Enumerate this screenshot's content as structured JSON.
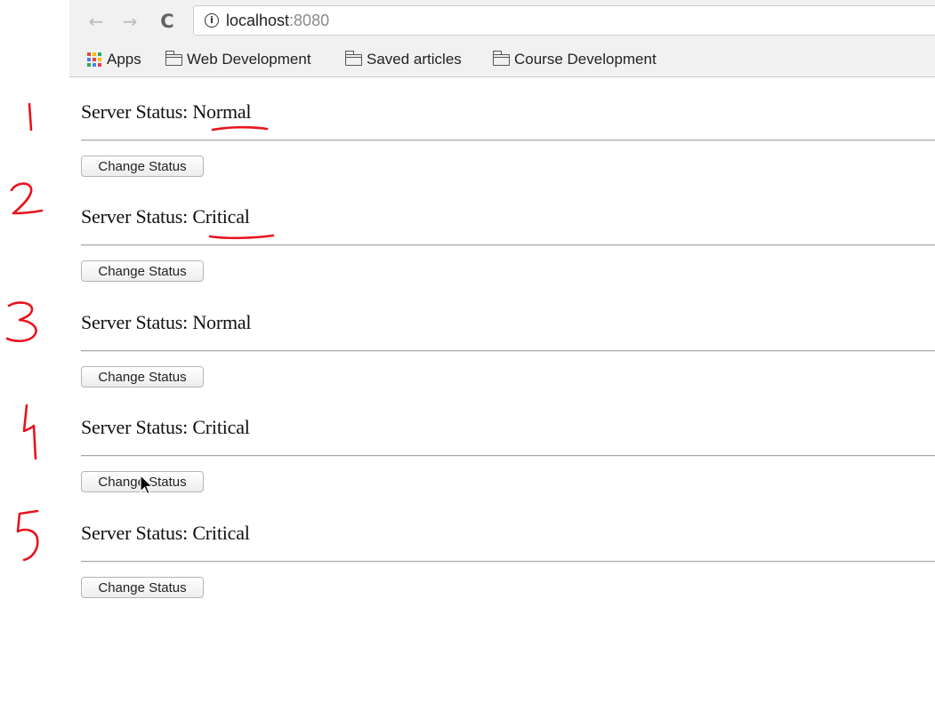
{
  "browser": {
    "back_icon": "←",
    "forward_icon": "→",
    "reload_icon": "C",
    "info_icon": "i",
    "url_host": "localhost",
    "url_port": ":8080"
  },
  "bookmarks": {
    "apps_label": "Apps",
    "items": [
      "Web Development",
      "Saved articles",
      "Course Development"
    ],
    "apps_colors": [
      "#ea4335",
      "#fbbc05",
      "#34a853",
      "#4285f4",
      "#ea4335",
      "#fbbc05",
      "#34a853",
      "#4285f4",
      "#ea4335"
    ]
  },
  "servers": [
    {
      "label": "Server Status: ",
      "status": "Normal",
      "button": "Change Status"
    },
    {
      "label": "Server Status: ",
      "status": "Critical",
      "button": "Change Status"
    },
    {
      "label": "Server Status: ",
      "status": "Normal",
      "button": "Change Status"
    },
    {
      "label": "Server Status: ",
      "status": "Critical",
      "button": "Change Status"
    },
    {
      "label": "Server Status: ",
      "status": "Critical",
      "button": "Change Status"
    }
  ],
  "annotations": {
    "color": "#e8141e",
    "numbers": [
      "1",
      "2",
      "3",
      "4",
      "5"
    ],
    "underlined_items": [
      0,
      1
    ]
  }
}
